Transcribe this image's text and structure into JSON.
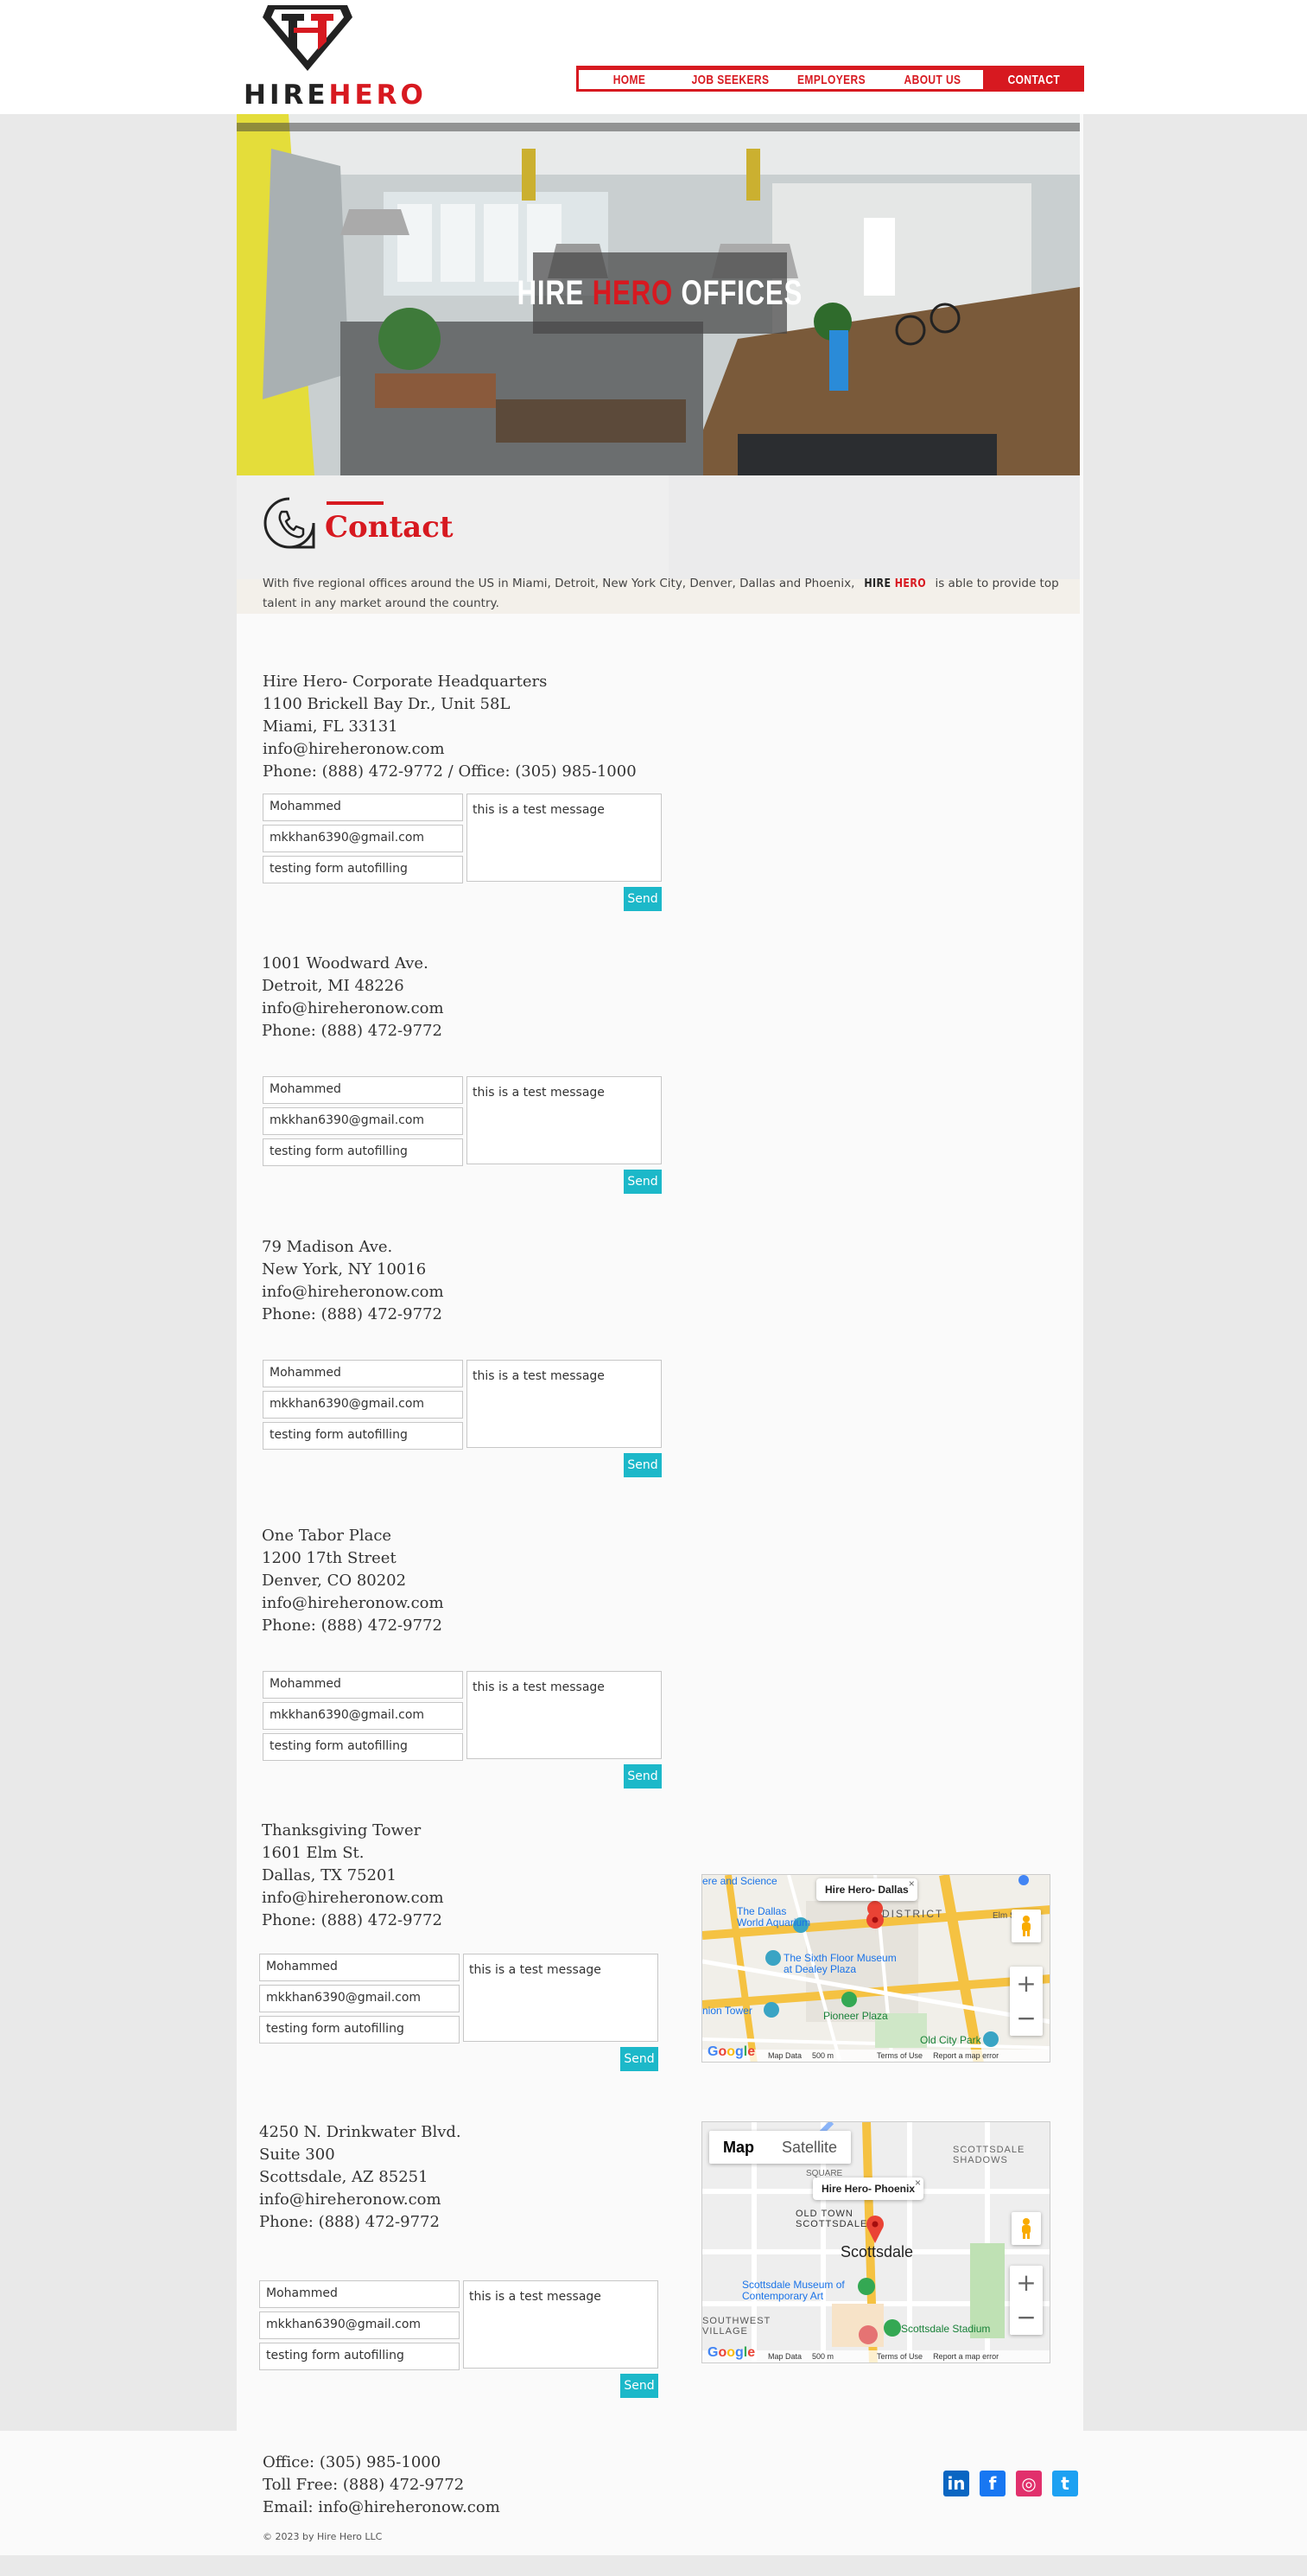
{
  "header": {
    "logo_text_left": "HIRE",
    "logo_text_right": "HERO",
    "nav": [
      {
        "label": "HOME"
      },
      {
        "label": "JOB SEEKERS"
      },
      {
        "label": "EMPLOYERS"
      },
      {
        "label": "ABOUT US"
      },
      {
        "label": "CONTACT",
        "active": true
      }
    ]
  },
  "hero": {
    "title_white_1": "HIRE ",
    "title_red": "HERO",
    "title_white_2": " OFFICES"
  },
  "contact": {
    "title": "Contact",
    "intro_before": "With five regional offices around the US in Miami, Detroit, New York City, Denver, Dallas and Phoenix, ",
    "intro_brand_1": "HIRE ",
    "intro_brand_2": "HERO",
    "intro_after": " is able to provide top talent in any market around the country."
  },
  "form_defaults": {
    "name": "Mohammed",
    "email": "mkkhan6390@gmail.com",
    "subject": "testing form autofilling",
    "message": "this is a test message",
    "send_label": "Send"
  },
  "offices": [
    {
      "lines": [
        "Hire Hero- Corporate Headquarters",
        "1100 Brickell Bay Dr., Unit 58L",
        "Miami, FL 33131",
        "info@hireheronow.com",
        "Phone: (888) 472-9772 / Office: (305) 985-1000"
      ]
    },
    {
      "lines": [
        "1001 Woodward Ave.",
        "Detroit, MI 48226",
        "info@hireheronow.com",
        "Phone: (888) 472-9772"
      ]
    },
    {
      "lines": [
        "79 Madison Ave.",
        "New York, NY 10016",
        "info@hireheronow.com",
        "Phone: (888) 472-9772"
      ]
    },
    {
      "lines": [
        "One Tabor Place",
        "1200 17th Street",
        "Denver, CO  80202",
        "info@hireheronow.com",
        "Phone: (888) 472-9772"
      ]
    },
    {
      "lines": [
        "Thanksgiving Tower",
        "1601 Elm St.",
        "Dallas, TX 75201",
        "info@hireheronow.com",
        "Phone: (888) 472-9772"
      ]
    },
    {
      "lines": [
        "4250 N. Drinkwater Blvd.",
        "Suite 300",
        "Scottsdale, AZ 85251",
        "info@hireheronow.com",
        "Phone: (888) 472-9772"
      ]
    }
  ],
  "maps": {
    "dallas": {
      "tag": "Hire Hero- Dallas",
      "labels": [
        "ere and Science",
        "The Dallas World Aquarium",
        "DISTRICT",
        "The Sixth Floor Museum at Dealey Plaza",
        "Pioneer Plaza",
        "nion Tower",
        "Old City Park",
        "Elm St"
      ],
      "footer": [
        "Map Data",
        "500 m",
        "Terms of Use",
        "Report a map error"
      ]
    },
    "phoenix": {
      "tag": "Hire Hero- Phoenix",
      "maptype": [
        "Map",
        "Satellite"
      ],
      "labels": [
        "SCOTTSDALE SHADOWS",
        "OLD TOWN SCOTTSDALE",
        "Scottsdale",
        "Scottsdale Museum of Contemporary Art",
        "SOUTHWEST VILLAGE",
        "Scottsdale Stadium",
        "SQUARE"
      ],
      "footer": [
        "Map Data",
        "500 m",
        "Terms of Use",
        "Report a map error"
      ]
    },
    "google": "Google",
    "close": "×",
    "zoom_in": "+",
    "zoom_out": "−"
  },
  "footer": {
    "office": "Office: (305) 985-1000",
    "tollfree": "Toll Free: (888) 472-9772",
    "email": "Email: info@hireheronow.com",
    "copyright": "© 2023 by Hire Hero LLC",
    "social": [
      {
        "name": "linkedin",
        "glyph": "in",
        "color": "#0a66c2"
      },
      {
        "name": "facebook",
        "glyph": "f",
        "color": "#1877f2"
      },
      {
        "name": "instagram",
        "glyph": "◎",
        "color": "#e1306c"
      },
      {
        "name": "twitter",
        "glyph": "t",
        "color": "#1da1f2"
      }
    ]
  },
  "colors": {
    "brand_red": "#d71920",
    "send_button": "#1cb8c9"
  }
}
